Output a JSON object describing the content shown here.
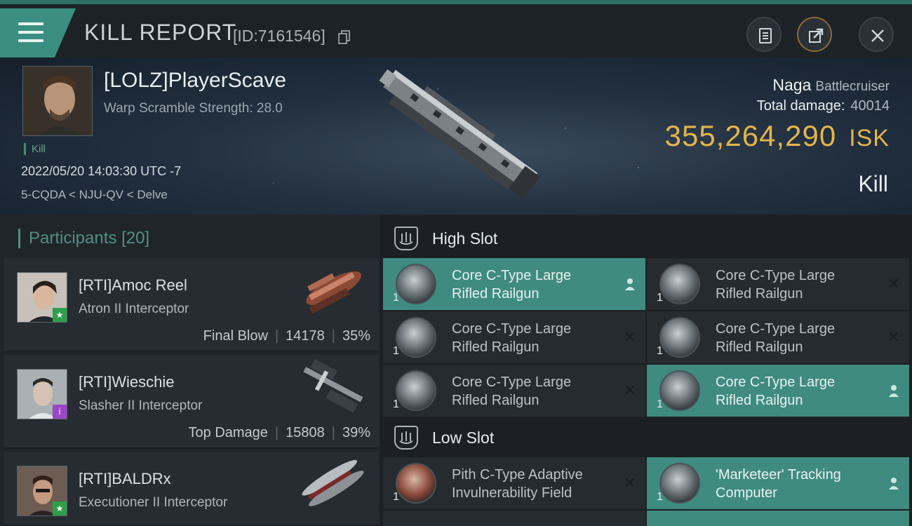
{
  "header": {
    "title": "KILL REPORT",
    "report_id": "[ID:7161546]",
    "buttons": [
      "clipboard",
      "share",
      "close"
    ]
  },
  "victim": {
    "name": "[LOLZ]PlayerScave",
    "warp_scramble": "Warp Scramble Strength: 28.0",
    "kill_tag": "Kill",
    "datetime": "2022/05/20 14:03:30 UTC -7",
    "location": "5-CQDA < NJU-QV < Delve",
    "ship_name": "Naga",
    "ship_class": "Battlecruiser",
    "total_damage_label": "Total damage:",
    "total_damage": "40014",
    "isk_value": "355,264,290",
    "isk_unit": "ISK",
    "result": "Kill"
  },
  "participants": {
    "heading": "Participants",
    "count": "[20]",
    "items": [
      {
        "name": "[RTI]Amoc Reel",
        "ship": "Atron II Interceptor",
        "role": "Final Blow",
        "damage": "14178",
        "percent": "35%",
        "badge": "★",
        "badge_color": "#2f9e4b"
      },
      {
        "name": "[RTI]Wieschie",
        "ship": "Slasher II Interceptor",
        "role": "Top Damage",
        "damage": "15808",
        "percent": "39%",
        "badge": "i",
        "badge_color": "#9b45c8"
      },
      {
        "name": "[RTI]BALDRx",
        "ship": "Executioner II Interceptor",
        "role": "",
        "damage": "",
        "percent": "",
        "badge": "★",
        "badge_color": "#2f9e4b"
      }
    ]
  },
  "high_slot": {
    "title": "High Slot",
    "modules": [
      {
        "line1": "Core C-Type Large",
        "line2": "Rifled Railgun",
        "qty": "1",
        "status": "person-icon",
        "active": true
      },
      {
        "line1": "Core C-Type Large",
        "line2": "Rifled Railgun",
        "qty": "1",
        "status": "close-icon",
        "active": false
      },
      {
        "line1": "Core C-Type Large",
        "line2": "Rifled Railgun",
        "qty": "1",
        "status": "close-icon",
        "active": false
      },
      {
        "line1": "Core C-Type Large",
        "line2": "Rifled Railgun",
        "qty": "1",
        "status": "close-icon",
        "active": false
      },
      {
        "line1": "Core C-Type Large",
        "line2": "Rifled Railgun",
        "qty": "1",
        "status": "close-icon",
        "active": false
      },
      {
        "line1": "Core C-Type Large",
        "line2": "Rifled Railgun",
        "qty": "1",
        "status": "person-icon",
        "active": true
      }
    ]
  },
  "low_slot": {
    "title": "Low Slot",
    "modules": [
      {
        "line1": "Pith C-Type Adaptive",
        "line2": "Invulnerability Field",
        "qty": "1",
        "status": "close-icon",
        "active": false
      },
      {
        "line1": "'Marketeer' Tracking",
        "line2": "Computer",
        "qty": "1",
        "status": "person-icon",
        "active": true
      }
    ]
  },
  "colors": {
    "accent": "#3f8b80",
    "isk": "#e3b44e",
    "background": "#1b1f23"
  }
}
